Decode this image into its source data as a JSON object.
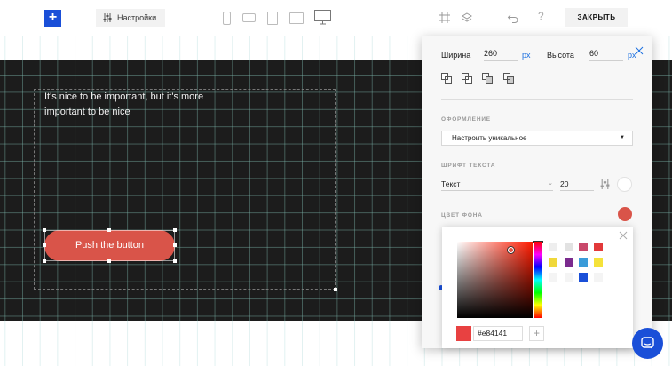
{
  "toolbar": {
    "add_label": "+",
    "settings_label": "Настройки",
    "close_label": "ЗАКРЫТЬ",
    "icons": [
      "phone-icon",
      "phone-landscape-icon",
      "tablet-icon",
      "tablet-landscape-icon",
      "desktop-icon",
      "grid-icon",
      "layers-icon",
      "undo-icon",
      "help-icon"
    ]
  },
  "canvas": {
    "text": "It's nice to be important, but it's more important to be nice",
    "button_label": "Push the button"
  },
  "panel": {
    "width_label": "Ширина",
    "width_value": "260",
    "width_unit": "px",
    "height_label": "Высота",
    "height_value": "60",
    "height_unit": "px",
    "style_section": "ОФОРМЛЕНИЕ",
    "style_select": "Настроить уникальное",
    "font_section": "ШРИФТ ТЕКСТА",
    "font_family": "Текст",
    "font_size": "20",
    "bg_section": "ЦВЕТ ФОНА",
    "text_color": "#ffffff",
    "bg_color": "#d95449"
  },
  "picker": {
    "hex_value": "#e84141",
    "current_color": "#e84141",
    "swatches": [
      "#eeeeee",
      "#e2e2e2",
      "#c9486b",
      "#e2393a",
      "#f0d83a",
      "#7b2b8e",
      "#3a9bd9",
      "#f5e23a",
      "#f4f4f4",
      "#f4f4f4",
      "#1a4fd8",
      "#f4f4f4"
    ]
  },
  "colors": {
    "accent": "#1a4fd8",
    "artboard": "#1c1c1c",
    "cta": "#d95449"
  }
}
